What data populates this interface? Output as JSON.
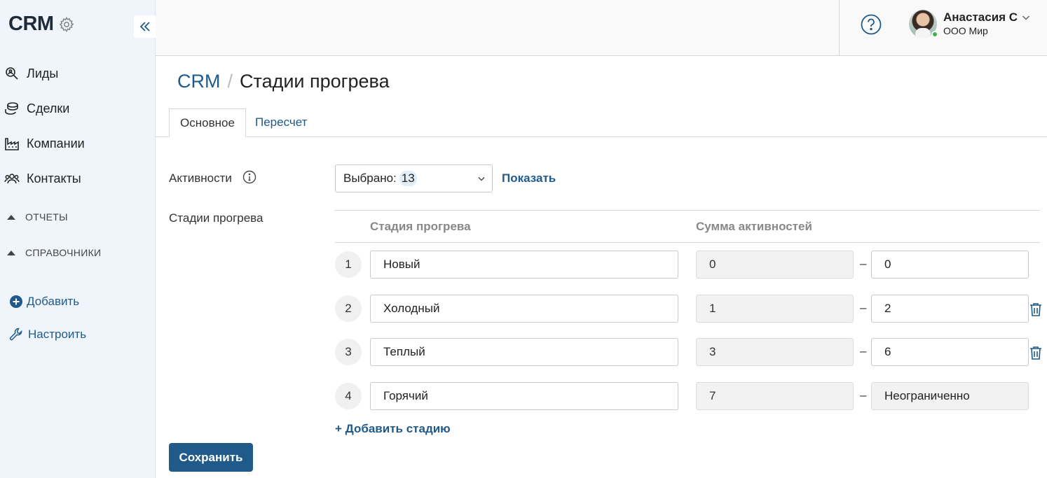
{
  "sidebar": {
    "brand": "CRM",
    "items": [
      {
        "label": "Лиды",
        "icon": "search-people-icon"
      },
      {
        "label": "Сделки",
        "icon": "coins-icon"
      },
      {
        "label": "Компании",
        "icon": "factory-icon"
      },
      {
        "label": "Контакты",
        "icon": "people-icon"
      }
    ],
    "sections": [
      "ОТЧЕТЫ",
      "СПРАВОЧНИКИ"
    ],
    "add_label": "Добавить",
    "configure_label": "Настроить"
  },
  "header": {
    "user_name": "Анастасия С",
    "user_org": "ООО Мир",
    "status_color": "#3fb24f"
  },
  "page": {
    "breadcrumb_root": "CRM",
    "breadcrumb_sep": "/",
    "title": "Стадии прогрева",
    "tabs": [
      "Основное",
      "Пересчет"
    ]
  },
  "form": {
    "activities_label": "Активности",
    "select_prefix": "Выбрано:",
    "select_count": "13",
    "show_link": "Показать",
    "stages_label": "Стадии прогрева",
    "col_stage": "Стадия прогрева",
    "col_sum": "Сумма активностей",
    "dash": "–",
    "stages": [
      {
        "num": "1",
        "name": "Новый",
        "from": "0",
        "to": "0"
      },
      {
        "num": "2",
        "name": "Холодный",
        "from": "1",
        "to": "2"
      },
      {
        "num": "3",
        "name": "Теплый",
        "from": "3",
        "to": "6"
      },
      {
        "num": "4",
        "name": "Горячий",
        "from": "7",
        "to": "Неограниченно"
      }
    ],
    "add_stage": "+ Добавить стадию",
    "save": "Сохранить"
  },
  "colors": {
    "accent": "#1f5a8a",
    "sidebar_bg": "#f0f5fb"
  }
}
